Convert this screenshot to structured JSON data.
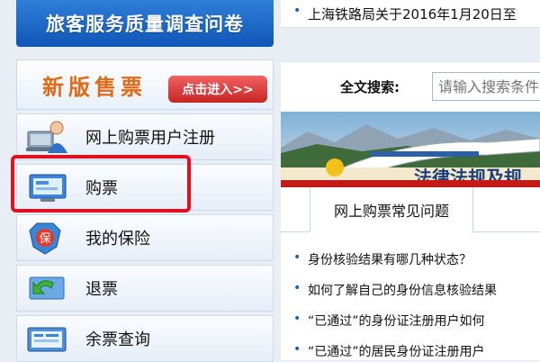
{
  "survey_banner": {
    "label": "旅客服务质量调查问卷"
  },
  "new_ticket": {
    "title": "新版售票",
    "enter_label": "点击进入>>"
  },
  "menu": [
    {
      "label": "网上购票用户注册",
      "icon": "computer-user-icon"
    },
    {
      "label": "购票",
      "icon": "ticket-screen-icon"
    },
    {
      "label": "我的保险",
      "icon": "insurance-shield-icon"
    },
    {
      "label": "退票",
      "icon": "refund-arrow-icon"
    },
    {
      "label": "余票查询",
      "icon": "ticket-query-icon"
    }
  ],
  "news": {
    "text": "上海铁路局关于2016年1月20日至"
  },
  "search": {
    "label": "全文搜索:",
    "placeholder": "请输入搜索条件"
  },
  "law_banner": {
    "text": "法律法规及规"
  },
  "faq": {
    "tab_label": "网上购票常见问题",
    "items": [
      "身份核验结果有哪几种状态？",
      "如何了解自己的身份信息核验结果",
      "“已通过”的身份证注册用户如何",
      "“已通过”的居民身份证注册用户"
    ]
  },
  "colors": {
    "accent_blue": "#0f56b8",
    "highlight_red": "#e01020",
    "orange": "#e06a18"
  }
}
